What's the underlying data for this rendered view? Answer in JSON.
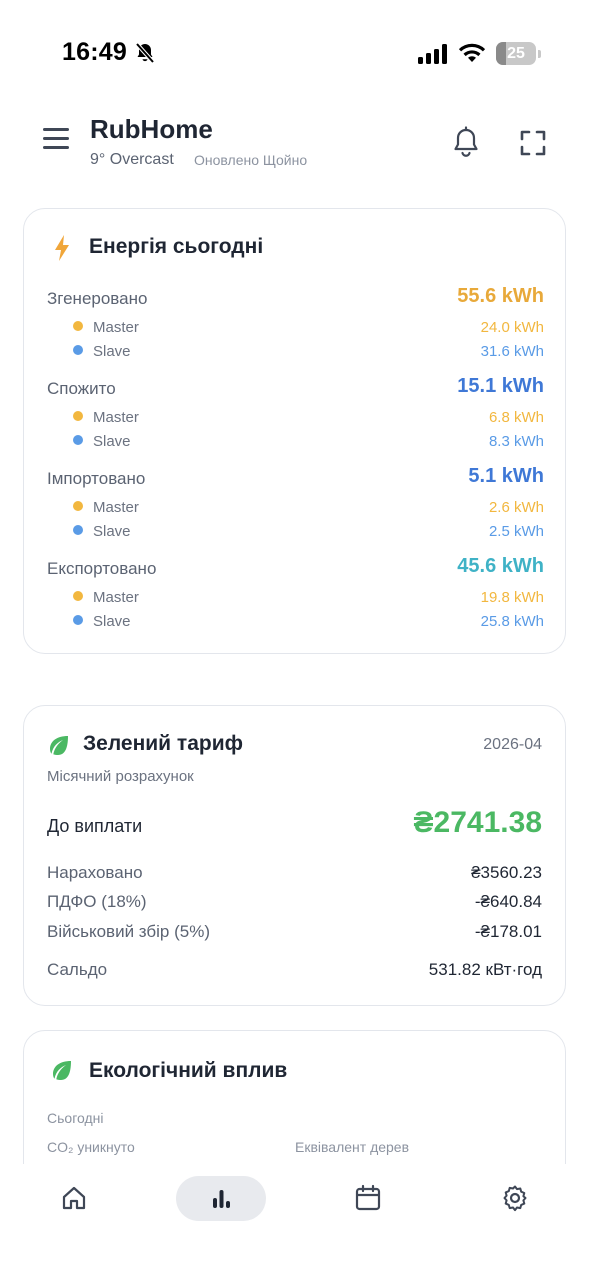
{
  "status_bar": {
    "time": "16:49",
    "battery_level": "25",
    "battery_fraction": 0.25
  },
  "header": {
    "app_title": "RubHome",
    "weather": "9° Overcast",
    "updated": "Оновлено Щойно"
  },
  "energy": {
    "title": "Енергія сьогодні",
    "rows": [
      {
        "label": "Згенеровано",
        "total": "55.6 kWh",
        "total_color": "#e8a93a",
        "master_label": "Master",
        "master_value": "24.0 kWh",
        "slave_label": "Slave",
        "slave_value": "31.6 kWh"
      },
      {
        "label": "Спожито",
        "total": "15.1 kWh",
        "total_color": "#3f78d6",
        "master_label": "Master",
        "master_value": "6.8 kWh",
        "slave_label": "Slave",
        "slave_value": "8.3 kWh"
      },
      {
        "label": "Імпортовано",
        "total": "5.1 kWh",
        "total_color": "#3f78d6",
        "master_label": "Master",
        "master_value": "2.6 kWh",
        "slave_label": "Slave",
        "slave_value": "2.5 kWh"
      },
      {
        "label": "Експортовано",
        "total": "45.6 kWh",
        "total_color": "#3fb2c6",
        "master_label": "Master",
        "master_value": "19.8 kWh",
        "slave_label": "Slave",
        "slave_value": "25.8 kWh"
      }
    ],
    "master_color": "#f2b73f",
    "slave_color": "#5a9be6"
  },
  "tariff": {
    "title": "Зелений тариф",
    "period": "2026-04",
    "subtitle": "Місячний розрахунок",
    "payout_label": "До виплати",
    "payout_value": "₴2741.38",
    "accrued_label": "Нараховано",
    "accrued_value": "₴3560.23",
    "pdfo_label": "ПДФО (18%)",
    "pdfo_value": "-₴640.84",
    "military_label": "Військовий збір (5%)",
    "military_value": "-₴178.01",
    "balance_label": "Сальдо",
    "balance_value": "531.82 кВт·год"
  },
  "eco": {
    "title": "Екологічний вплив",
    "today": "Сьогодні",
    "co2": "CO₂ уникнуто",
    "trees": "Еквівалент дерев"
  },
  "nav": {
    "items": [
      "home-icon",
      "stats-icon",
      "calendar-icon",
      "settings-icon"
    ],
    "active": "stats-icon"
  },
  "colors": {
    "accent_green": "#4bb863",
    "energy_icon": "#f0a63a"
  }
}
